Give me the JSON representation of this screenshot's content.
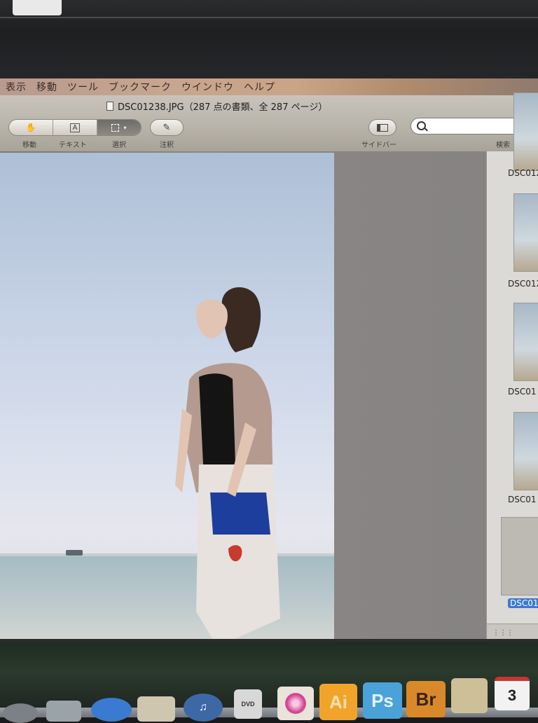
{
  "menubar": {
    "items": [
      "表示",
      "移動",
      "ツール",
      "ブックマーク",
      "ウインドウ",
      "ヘルプ"
    ]
  },
  "window": {
    "title": "DSC01238.JPG（287 点の書類、全 287 ページ）"
  },
  "toolbar": {
    "segments": [
      {
        "label": "移動",
        "icon": "hand-icon"
      },
      {
        "label": "テキスト",
        "icon": "text-cursor-icon"
      },
      {
        "label": "選択",
        "icon": "selection-rect-icon"
      }
    ],
    "annotate_label": "注釈",
    "sidebar_label": "サイドバー",
    "search_label": "検索",
    "search_placeholder": ""
  },
  "sidebar": {
    "thumbnails": [
      {
        "label": "DSC012"
      },
      {
        "label": "DSC012"
      },
      {
        "label": "DSC01"
      },
      {
        "label": "DSC01"
      },
      {
        "label": "DSC01",
        "selected": true
      }
    ]
  },
  "dock": {
    "items": [
      {
        "name": "dvd-player-icon",
        "text": "DVD"
      },
      {
        "name": "flower-icon",
        "text": ""
      },
      {
        "name": "illustrator-icon",
        "text": "Ai"
      },
      {
        "name": "photoshop-icon",
        "text": "Ps"
      },
      {
        "name": "bridge-icon",
        "text": "Br"
      },
      {
        "name": "calendar-icon",
        "text": "3"
      }
    ]
  },
  "colors": {
    "selection": "#3b78d3",
    "ai_bg": "#f2a32a",
    "ps_bg": "#4aa2d9",
    "br_bg": "#d9892a"
  }
}
